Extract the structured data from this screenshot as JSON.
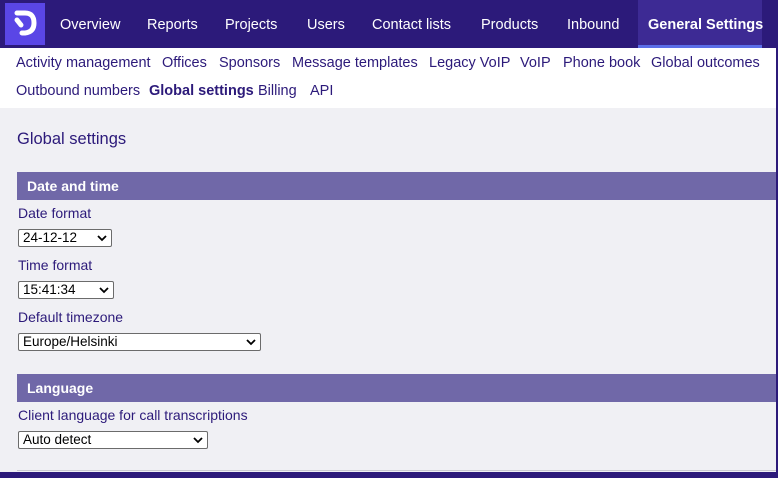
{
  "topnav": {
    "items": [
      {
        "label": "Overview"
      },
      {
        "label": "Reports"
      },
      {
        "label": "Projects"
      },
      {
        "label": "Users"
      },
      {
        "label": "Contact lists"
      },
      {
        "label": "Products"
      },
      {
        "label": "Inbound"
      },
      {
        "label": "General Settings",
        "active": true
      }
    ]
  },
  "subnav": {
    "items": [
      {
        "label": "Activity management"
      },
      {
        "label": "Offices"
      },
      {
        "label": "Sponsors"
      },
      {
        "label": "Message templates"
      },
      {
        "label": "Legacy VoIP"
      },
      {
        "label": "VoIP"
      },
      {
        "label": "Phone book"
      },
      {
        "label": "Global outcomes"
      },
      {
        "label": "Outbound numbers"
      },
      {
        "label": "Global settings",
        "active": true
      },
      {
        "label": "Billing"
      },
      {
        "label": "API"
      }
    ]
  },
  "page": {
    "title": "Global settings",
    "sections": {
      "date_time": {
        "title": "Date and time",
        "date_format": {
          "label": "Date format",
          "value": "24-12-12"
        },
        "time_format": {
          "label": "Time format",
          "value": "15:41:34"
        },
        "timezone": {
          "label": "Default timezone",
          "value": "Europe/Helsinki"
        }
      },
      "language": {
        "title": "Language",
        "client_language": {
          "label": "Client language for call transcriptions",
          "value": "Auto detect"
        }
      }
    }
  },
  "icons": {
    "logo": "brand-logo-icon",
    "select_arrow": "chevron-down-icon"
  },
  "colors": {
    "nav_bg": "#2c1a7a",
    "logo_bg": "#5a46e6",
    "section_bar": "#7068a8",
    "content_bg": "#f0f0f4",
    "active_underline": "#5b6ee8"
  }
}
